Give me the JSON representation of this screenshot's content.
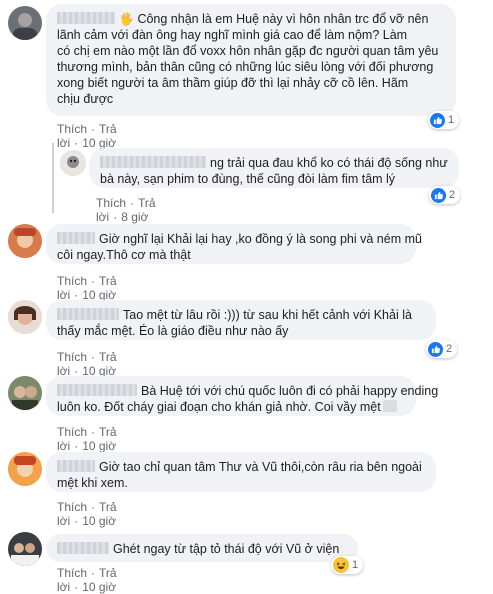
{
  "comments": [
    {
      "text": "Công nhận là em Huệ này vì hôn nhân trc đổ vỡ nên lãnh cảm với đàn ông hay nghĩ mình giá cao để làm nộm? Làm có chị em nào một lần đổ voxx hôn nhân gặp đc người quan tâm yêu thương mình, bản thân cũng có những lúc siêu lòng với đối phương xong biết người ta âm thầm giúp đỡ thì lại nhảy cỡ cồ lên. Hãm chịu được",
      "line1": "Công nhận là em Huệ này vì hôn nhân trc đổ vỡ nên",
      "line2": "lãnh cảm với đàn ông hay nghĩ mình giá cao để làm nộm? Làm",
      "line3": "có chị em nào một lần đổ voxx hôn nhân gặp đc người quan tâm yêu",
      "line4": "thương mình, bản thân cũng có những lúc siêu lòng với đối phương",
      "line5": "xong biết người ta âm thầm giúp đỡ thì lại nhảy cỡ cồ lên. Hãm",
      "line6": "chịu được",
      "like": "Thích",
      "reply": "Trả lời",
      "time": "10 giờ",
      "reactions": "1"
    },
    {
      "line1": "ng trải qua đau khổ ko có thái độ sống như",
      "line2": "bà này, sạn phim to đùng, thế cũng đòi làm fim tâm lý",
      "like": "Thích",
      "reply": "Trả lời",
      "time": "8 giờ",
      "reactions": "2"
    },
    {
      "line1": "Giờ nghĩ lại Khải lại hay ,ko đồng ý là song phi và ném mũ",
      "line2": "côi ngay.Thô cơ mà thật",
      "like": "Thích",
      "reply": "Trả lời",
      "time": "10 giờ"
    },
    {
      "line1": "Tao mệt từ lâu rồi :))) từ sau khi hết cảnh với Khải là",
      "line2": "thấy mắc mệt. Éo là giáo điều như nào ấy",
      "like": "Thích",
      "reply": "Trả lời",
      "time": "10 giờ",
      "reactions": "2"
    },
    {
      "line1": "Bà Huệ tới với chú quốc luôn đi có phải happy ending",
      "line2": "luôn ko. Đốt cháy giai đoạn cho khán giả nhờ. Coi vầy mệt",
      "like": "Thích",
      "reply": "Trả lời",
      "time": "10 giờ"
    },
    {
      "line1": "Giờ tao chỉ quan tâm Thư và Vũ thôi,còn râu ria bên ngoài",
      "line2": "mệt khi xem.",
      "like": "Thích",
      "reply": "Trả lời",
      "time": "10 giờ"
    },
    {
      "line1": "Ghét ngay từ tập tỏ thái độ với Vũ ở viện",
      "like": "Thích",
      "reply": "Trả lời",
      "time": "10 giờ",
      "reactions": "1"
    }
  ],
  "colors": {
    "bubble": "#f0f2f5",
    "like_blue": "#1877f2",
    "meta_gray": "#65676b",
    "text": "#1c1e21"
  }
}
